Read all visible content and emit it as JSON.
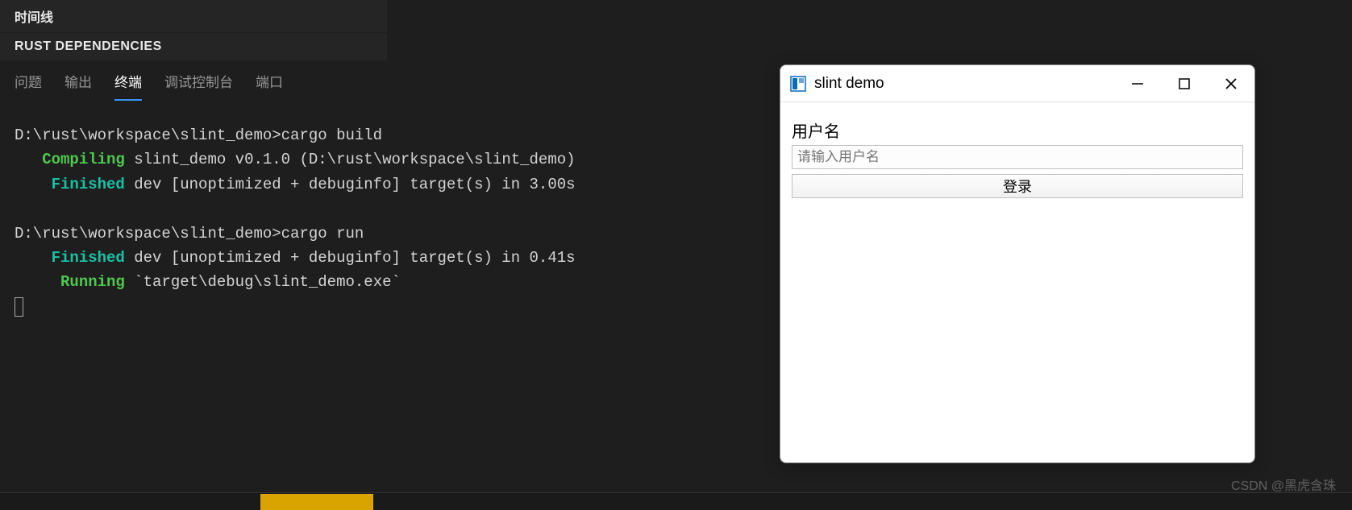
{
  "sidebar": {
    "timeline_label": "时间线",
    "rust_deps_label": "RUST DEPENDENCIES"
  },
  "panel": {
    "tabs": {
      "problems": "问题",
      "output": "输出",
      "terminal": "终端",
      "debug_console": "调试控制台",
      "ports": "端口"
    }
  },
  "terminal": {
    "line1_prompt": "D:\\rust\\workspace\\slint_demo>",
    "line1_cmd": "cargo build",
    "line2_status": "Compiling",
    "line2_rest": " slint_demo v0.1.0 (D:\\rust\\workspace\\slint_demo)",
    "line3_status": "Finished",
    "line3_rest": " dev [unoptimized + debuginfo] target(s) in 3.00s",
    "line4_prompt": "D:\\rust\\workspace\\slint_demo>",
    "line4_cmd": "cargo run",
    "line5_status": "Finished",
    "line5_rest": " dev [unoptimized + debuginfo] target(s) in 0.41s",
    "line6_status": "Running",
    "line6_rest": " `target\\debug\\slint_demo.exe`"
  },
  "app_window": {
    "title": "slint demo",
    "form": {
      "username_label": "用户名",
      "username_placeholder": "请输入用户名",
      "login_button": "登录"
    }
  },
  "watermark": "CSDN @黑虎含珠"
}
